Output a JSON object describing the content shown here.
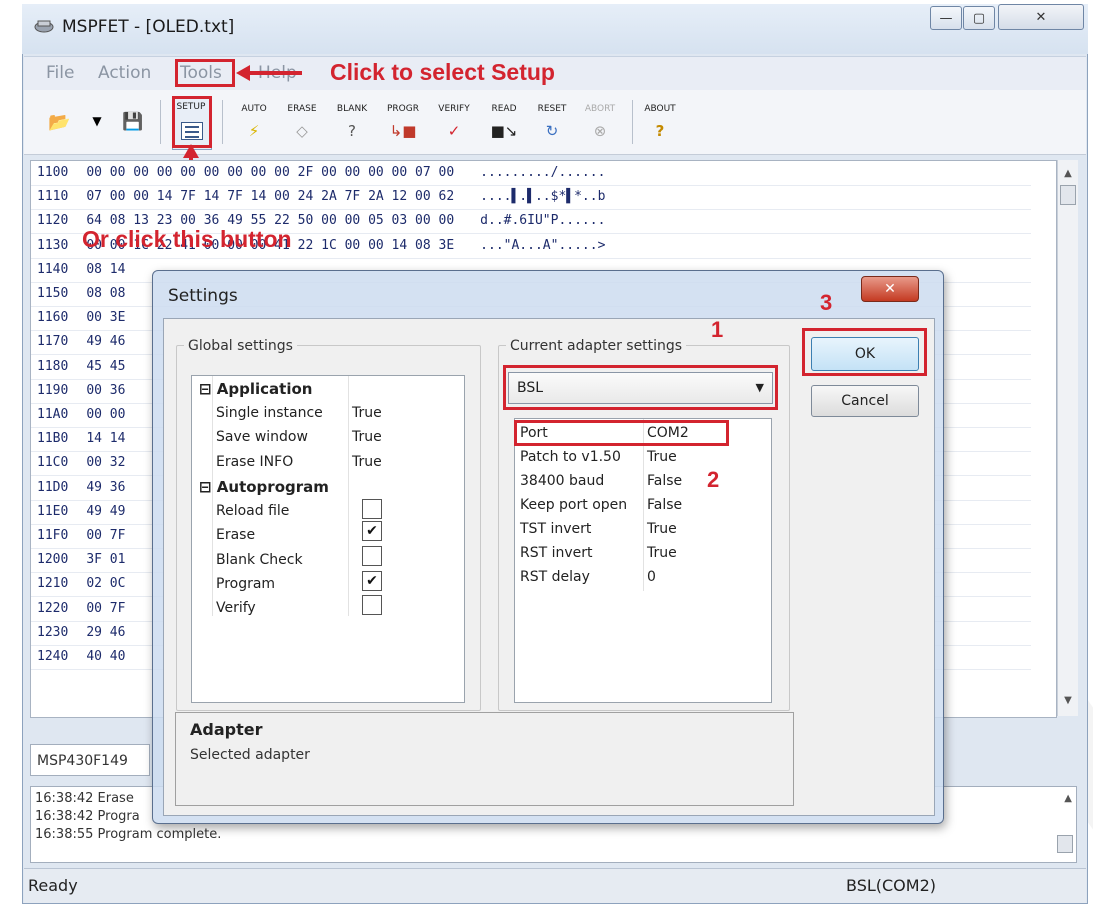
{
  "window": {
    "title": "MSPFET - [OLED.txt]",
    "controls": {
      "minimize": "—",
      "maximize": "▢",
      "close": "✕"
    }
  },
  "menu": [
    "File",
    "Action",
    "Tools",
    "Help"
  ],
  "annotations": {
    "setup_hint": "Click to select Setup",
    "button_hint": "Or click this button",
    "step1": "1",
    "step2": "2",
    "step3": "3"
  },
  "toolbar": {
    "setup": "SETUP",
    "auto": "AUTO",
    "erase": "ERASE",
    "blank": "BLANK",
    "progr": "PROGR",
    "verify": "VERIFY",
    "read": "READ",
    "reset": "RESET",
    "abort": "ABORT",
    "about": "ABOUT"
  },
  "hex_rows": [
    {
      "addr": "1100",
      "bytes": "00 00 00 00 00 00 00 00 00 2F 00 00 00 00 07 00",
      "ascii": "........./......"
    },
    {
      "addr": "1110",
      "bytes": "07 00 00 14 7F 14 7F 14 00 24 2A 7F 2A 12 00 62",
      "ascii": "....▌.▌..$*▌*..b"
    },
    {
      "addr": "1120",
      "bytes": "64 08 13 23 00 36 49 55 22 50 00 00 05 03 00 00",
      "ascii": "d..#.6IU\"P......"
    },
    {
      "addr": "1130",
      "bytes": "00 00 1C 22 41 00 00 00 41 22 1C 00 00 14 08 3E",
      "ascii": "...\"A...A\".....>"
    },
    {
      "addr": "1140",
      "bytes": "08 14",
      "ascii": ""
    },
    {
      "addr": "1150",
      "bytes": "08 08",
      "ascii": ""
    },
    {
      "addr": "1160",
      "bytes": "00 3E",
      "ascii": ""
    },
    {
      "addr": "1170",
      "bytes": "49 46",
      "ascii": ""
    },
    {
      "addr": "1180",
      "bytes": "45 45",
      "ascii": ""
    },
    {
      "addr": "1190",
      "bytes": "00 36",
      "ascii": ""
    },
    {
      "addr": "11A0",
      "bytes": "00 00",
      "ascii": ""
    },
    {
      "addr": "11B0",
      "bytes": "14 14",
      "ascii": ""
    },
    {
      "addr": "11C0",
      "bytes": "00 32",
      "ascii": ""
    },
    {
      "addr": "11D0",
      "bytes": "49 36",
      "ascii": ""
    },
    {
      "addr": "11E0",
      "bytes": "49 49",
      "ascii": ""
    },
    {
      "addr": "11F0",
      "bytes": "00 7F",
      "ascii": ""
    },
    {
      "addr": "1200",
      "bytes": "3F 01",
      "ascii": ""
    },
    {
      "addr": "1210",
      "bytes": "02 0C",
      "ascii": ""
    },
    {
      "addr": "1220",
      "bytes": "00 7F",
      "ascii": ""
    },
    {
      "addr": "1230",
      "bytes": "29 46",
      "ascii": ""
    },
    {
      "addr": "1240",
      "bytes": "40 40",
      "ascii": ""
    }
  ],
  "device": "MSP430F149",
  "log": [
    "16:38:42 Erase",
    "16:38:42 Progra",
    "16:38:55 Program complete."
  ],
  "status": {
    "left": "Ready",
    "right": "BSL(COM2)"
  },
  "dialog": {
    "title": "Settings",
    "close": "✕",
    "global_title": "Global settings",
    "adapter_title": "Current adapter settings",
    "application": {
      "header": "Application",
      "items": [
        {
          "name": "Single instance",
          "value": "True"
        },
        {
          "name": "Save window",
          "value": "True"
        },
        {
          "name": "Erase INFO",
          "value": "True"
        }
      ]
    },
    "autoprogram": {
      "header": "Autoprogram",
      "items": [
        {
          "name": "Reload file",
          "checked": false
        },
        {
          "name": "Erase",
          "checked": true
        },
        {
          "name": "Blank Check",
          "checked": false
        },
        {
          "name": "Program",
          "checked": true
        },
        {
          "name": "Verify",
          "checked": false
        }
      ]
    },
    "adapter_selected": "BSL",
    "adapter_props": [
      {
        "name": "Port",
        "value": "COM2"
      },
      {
        "name": "Patch to v1.50",
        "value": "True"
      },
      {
        "name": "38400 baud",
        "value": "False"
      },
      {
        "name": "Keep port open",
        "value": "False"
      },
      {
        "name": "TST invert",
        "value": "True"
      },
      {
        "name": "RST invert",
        "value": "True"
      },
      {
        "name": "RST delay",
        "value": "0"
      }
    ],
    "ok": "OK",
    "cancel": "Cancel",
    "desc_title": "Adapter",
    "desc_text": "Selected adapter"
  }
}
